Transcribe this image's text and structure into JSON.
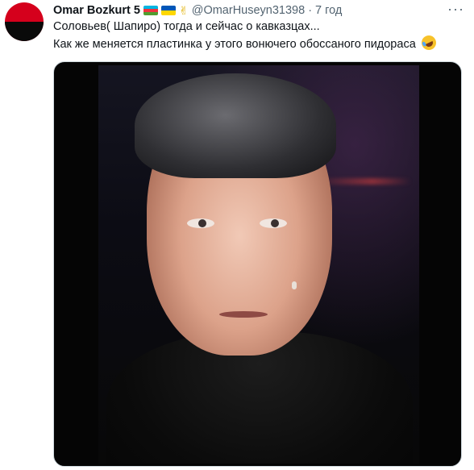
{
  "tweet": {
    "display_name": "Omar Bozkurt 5",
    "handle": "@OmarHuseyn31398",
    "separator": "·",
    "time": "7 год",
    "more_label": "···",
    "text_line1": "Соловьев( Шапиро) тогда и сейчас о кавказцах...",
    "text_line2": "Как же меняется пластинка у этого вонючего обоссаного пидораса",
    "emojis": [
      "azerbaijan-flag",
      "ukraine-flag",
      "victory-hand",
      "rolling-on-floor-laughing"
    ]
  },
  "colors": {
    "avatar_top": "#d5001c",
    "avatar_bottom": "#0a0a0a",
    "name_color": "#0f1419",
    "secondary": "#536471",
    "media_bg": "#050505"
  }
}
